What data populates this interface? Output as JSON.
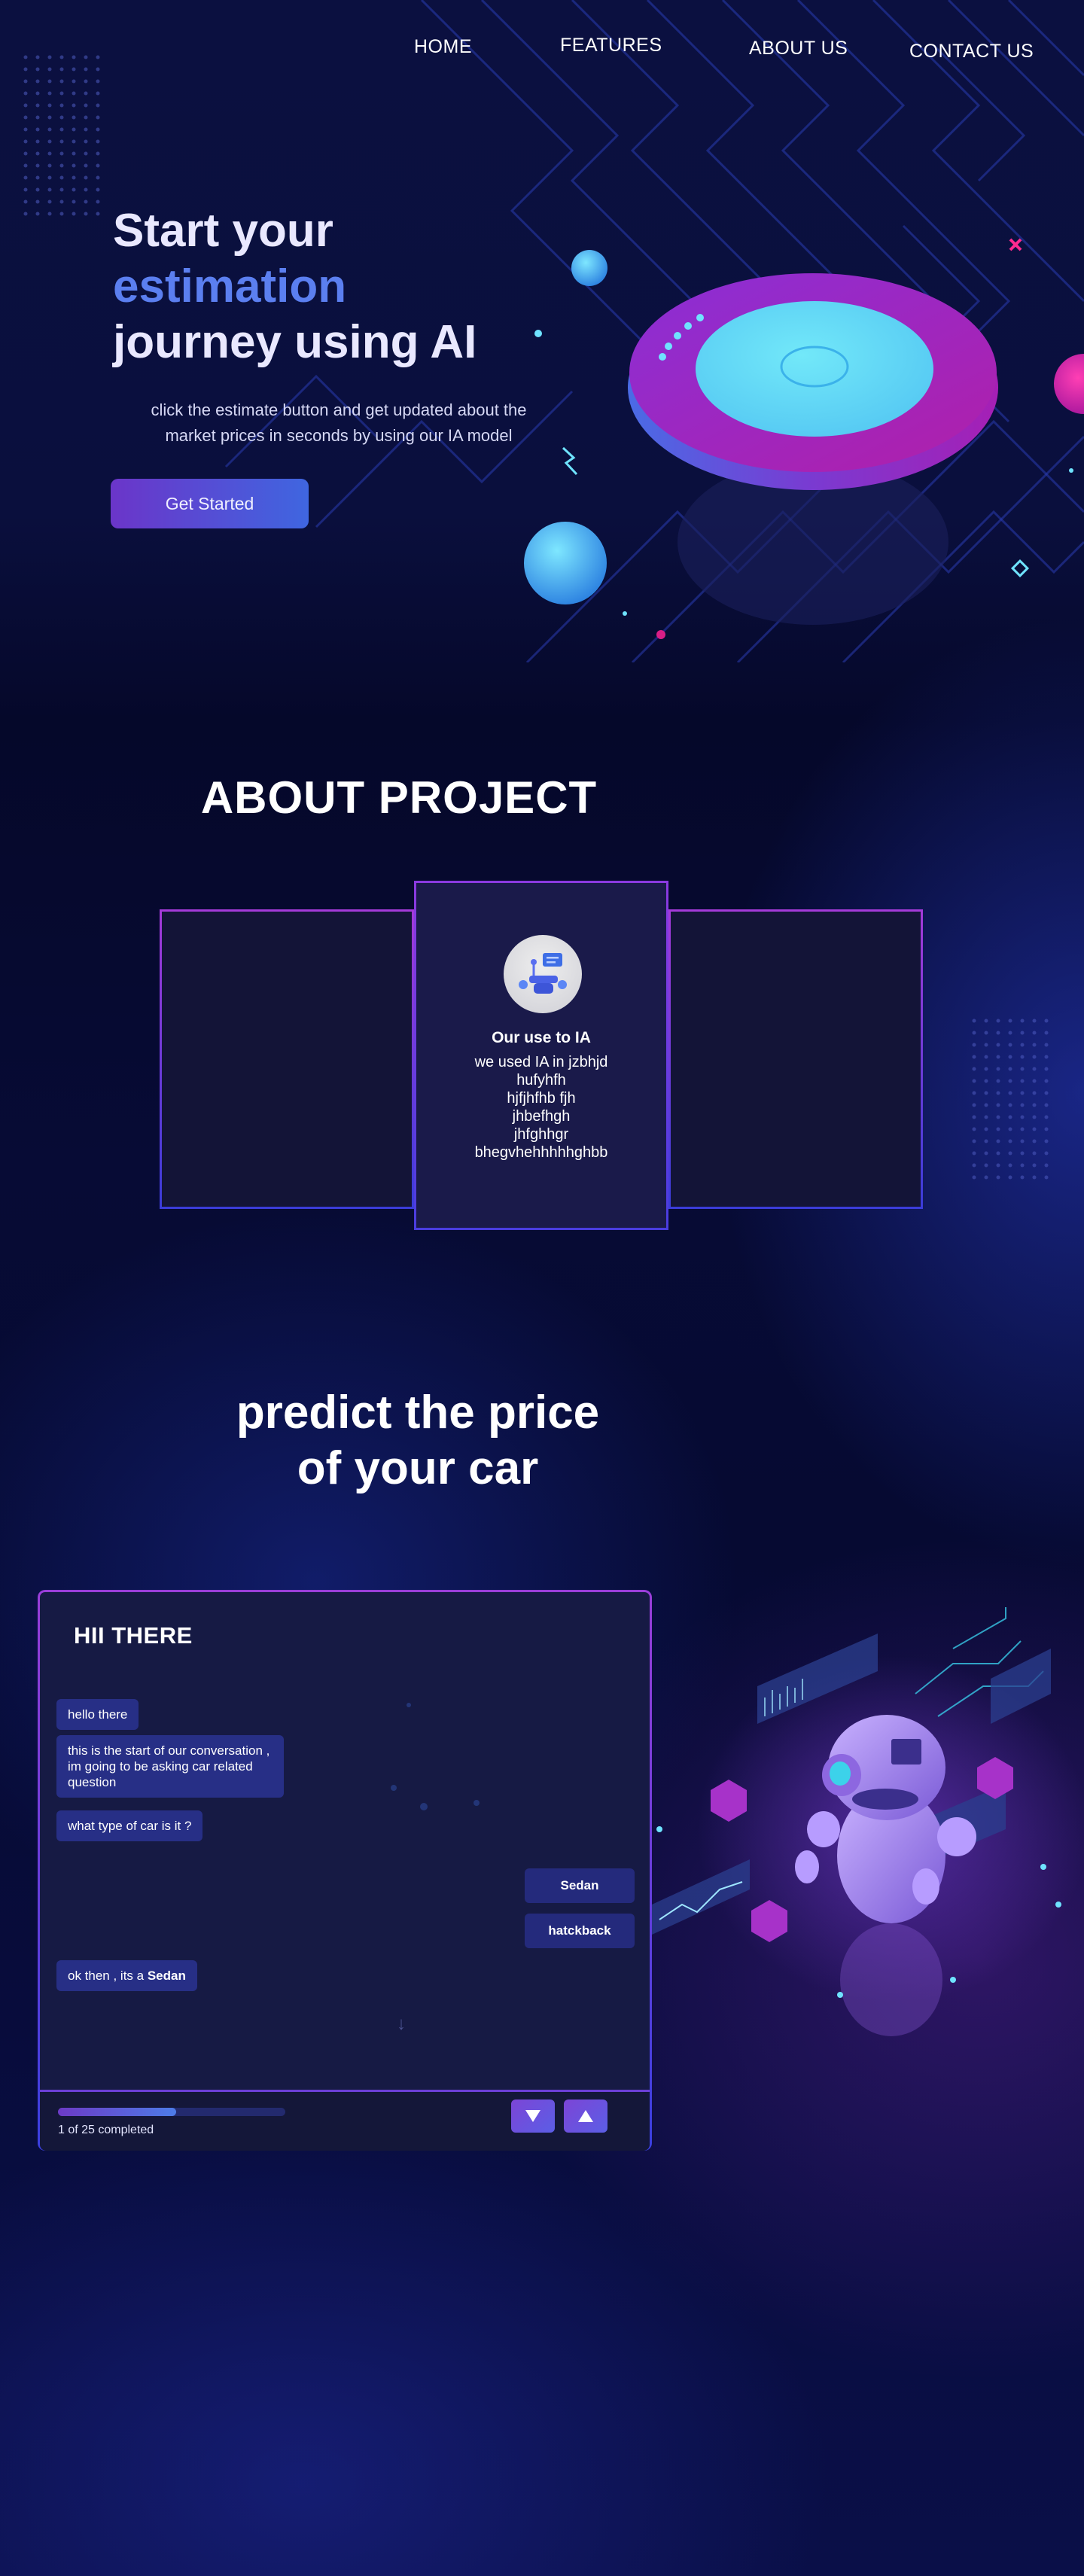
{
  "nav": {
    "home": "HOME",
    "features": "FEATURES",
    "about": "ABOUT US",
    "contact": "CONTACT US"
  },
  "hero": {
    "title_line1": "Start your",
    "title_line2": "estimation",
    "title_line3": "journey using AI",
    "subtitle_line1": "click the estimate button and get updated about the",
    "subtitle_line2": "market prices in seconds by using our IA model",
    "cta": "Get Started"
  },
  "about": {
    "title": "ABOUT PROJECT",
    "card": {
      "title": "Our use to IA",
      "body": [
        "we used IA in jzbhjd",
        "hufyhfh",
        "hjfjhfhb fjh",
        "jhbefhgh",
        "jhfghhgr",
        "bhegvhehhhhhghbb"
      ]
    }
  },
  "predict": {
    "title_line1": "predict the price",
    "title_line2": "of your car"
  },
  "chat": {
    "header": "HII THERE",
    "messages": {
      "m1": "hello there",
      "m2": "this is the start of our conversation , im going to be asking car related question",
      "m3": "what type of car is it ?",
      "m4_prefix": "ok then , its a ",
      "m4_value": "Sedan"
    },
    "options": {
      "opt1": "Sedan",
      "opt2": "hatckback"
    },
    "scroll_hint_icon": "arrow-down-icon",
    "progress": {
      "fraction": 0.52,
      "text": "1 of 25 completed"
    },
    "buttons": {
      "down_icon": "triangle-down-icon",
      "up_icon": "triangle-up-icon"
    }
  },
  "colors": {
    "accent_blue": "#5b7ff0",
    "accent_purple": "#6b35c9",
    "bubble": "#272f86"
  }
}
